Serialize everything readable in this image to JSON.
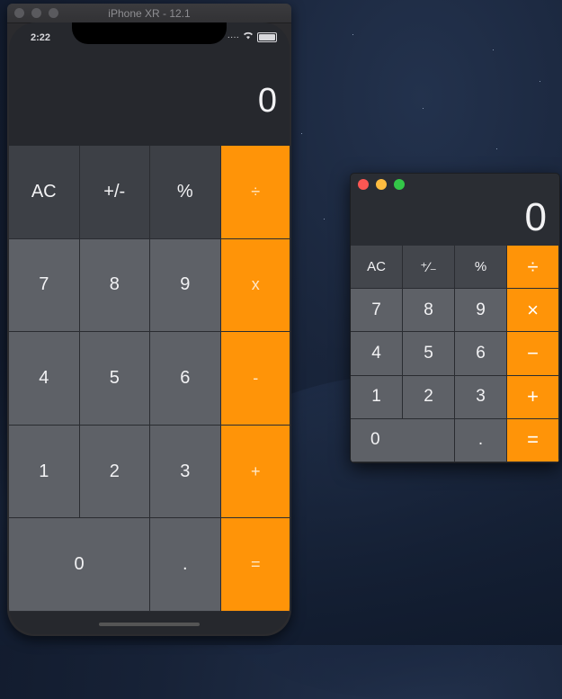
{
  "simulator": {
    "title": "iPhone XR - 12.1",
    "status_time": "2:22",
    "display": "0",
    "keys": [
      "AC",
      "+/-",
      "%",
      "÷",
      "7",
      "8",
      "9",
      "x",
      "4",
      "5",
      "6",
      "-",
      "1",
      "2",
      "3",
      "+",
      "0",
      ".",
      "="
    ]
  },
  "mac_calculator": {
    "display": "0",
    "keys": [
      "AC",
      "⁺∕₋",
      "%",
      "÷",
      "7",
      "8",
      "9",
      "×",
      "4",
      "5",
      "6",
      "−",
      "1",
      "2",
      "3",
      "+",
      "0",
      ".",
      "="
    ]
  },
  "colors": {
    "operator_orange": "#ff9408",
    "function_key": "#3d4046",
    "number_key": "#5e6167",
    "traffic_red": "#fc5753",
    "traffic_yellow": "#fdbc40",
    "traffic_green": "#33c748"
  }
}
